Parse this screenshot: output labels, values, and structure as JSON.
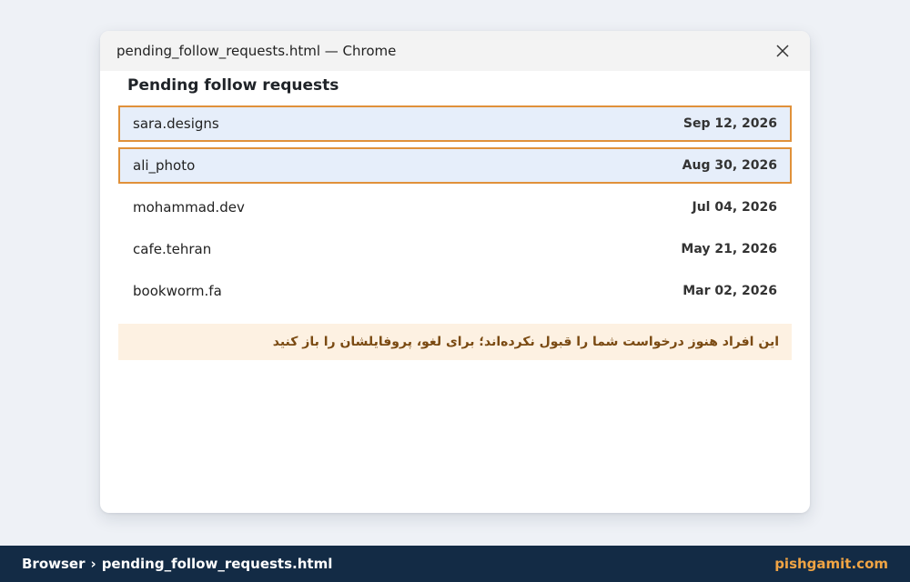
{
  "window": {
    "title": "pending_follow_requests.html — Chrome"
  },
  "page": {
    "title": "Pending follow requests",
    "requests": [
      {
        "username": "sara.designs",
        "date": "Sep 12, 2026",
        "highlighted": true
      },
      {
        "username": "ali_photo",
        "date": "Aug 30, 2026",
        "highlighted": true
      },
      {
        "username": "mohammad.dev",
        "date": "Jul 04, 2026",
        "highlighted": false
      },
      {
        "username": "cafe.tehran",
        "date": "May 21, 2026",
        "highlighted": false
      },
      {
        "username": "bookworm.fa",
        "date": "Mar 02, 2026",
        "highlighted": false
      }
    ],
    "note": "این افراد هنوز درخواست شما را قبول نکرده‌اند؛ برای لغو، پروفایلشان را باز کنید"
  },
  "footer": {
    "breadcrumb_root": "Browser",
    "breadcrumb_separator": "›",
    "breadcrumb_file": "pending_follow_requests.html",
    "brand": "pishgamit.com"
  },
  "colors": {
    "highlight_border": "#e0913a",
    "highlight_bg": "#e6eefa",
    "footer_bg": "#132b45",
    "brand": "#f0a444",
    "note_bg": "#fdf1e2"
  },
  "icons": {
    "close": "close-icon"
  }
}
